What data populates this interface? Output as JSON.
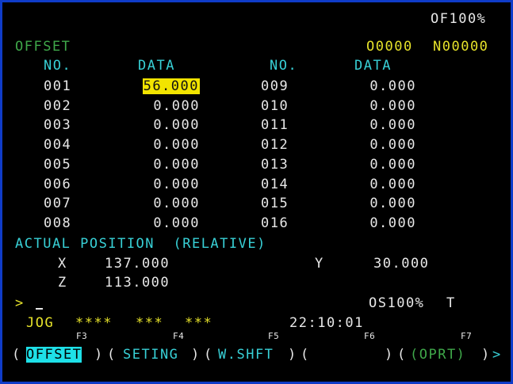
{
  "status": {
    "override": "OF100%"
  },
  "header": {
    "title": "OFFSET",
    "program": "O0000",
    "sequence": "N00000"
  },
  "columns": {
    "no1": "NO.",
    "data1": "DATA",
    "no2": "NO.",
    "data2": "DATA"
  },
  "offsets_left": [
    {
      "no": "001",
      "data": "56.000",
      "selected": true
    },
    {
      "no": "002",
      "data": "0.000"
    },
    {
      "no": "003",
      "data": "0.000"
    },
    {
      "no": "004",
      "data": "0.000"
    },
    {
      "no": "005",
      "data": "0.000"
    },
    {
      "no": "006",
      "data": "0.000"
    },
    {
      "no": "007",
      "data": "0.000"
    },
    {
      "no": "008",
      "data": "0.000"
    }
  ],
  "offsets_right": [
    {
      "no": "009",
      "data": "0.000"
    },
    {
      "no": "010",
      "data": "0.000"
    },
    {
      "no": "011",
      "data": "0.000"
    },
    {
      "no": "012",
      "data": "0.000"
    },
    {
      "no": "013",
      "data": "0.000"
    },
    {
      "no": "014",
      "data": "0.000"
    },
    {
      "no": "015",
      "data": "0.000"
    },
    {
      "no": "016",
      "data": "0.000"
    }
  ],
  "position": {
    "title": "ACTUAL POSITION  (RELATIVE)",
    "x_label": "X",
    "x_value": "137.000",
    "y_label": "Y",
    "y_value": "30.000",
    "z_label": "Z",
    "z_value": "113.000"
  },
  "input": {
    "prompt": ">"
  },
  "spindle": {
    "override": "OS100%",
    "tool": "T"
  },
  "mode": {
    "name": "JOG",
    "field1": "****",
    "field2": "***",
    "field3": "***",
    "clock": "22:10:01"
  },
  "softkeys": {
    "f3": "F3",
    "f4": "F4",
    "f5": "F5",
    "f6": "F6",
    "f7": "F7",
    "offset": "OFFSET",
    "seting": "SETING",
    "wshft": "W.SHFT",
    "blank": "",
    "oprt": "(OPRT)",
    "more": ">"
  }
}
